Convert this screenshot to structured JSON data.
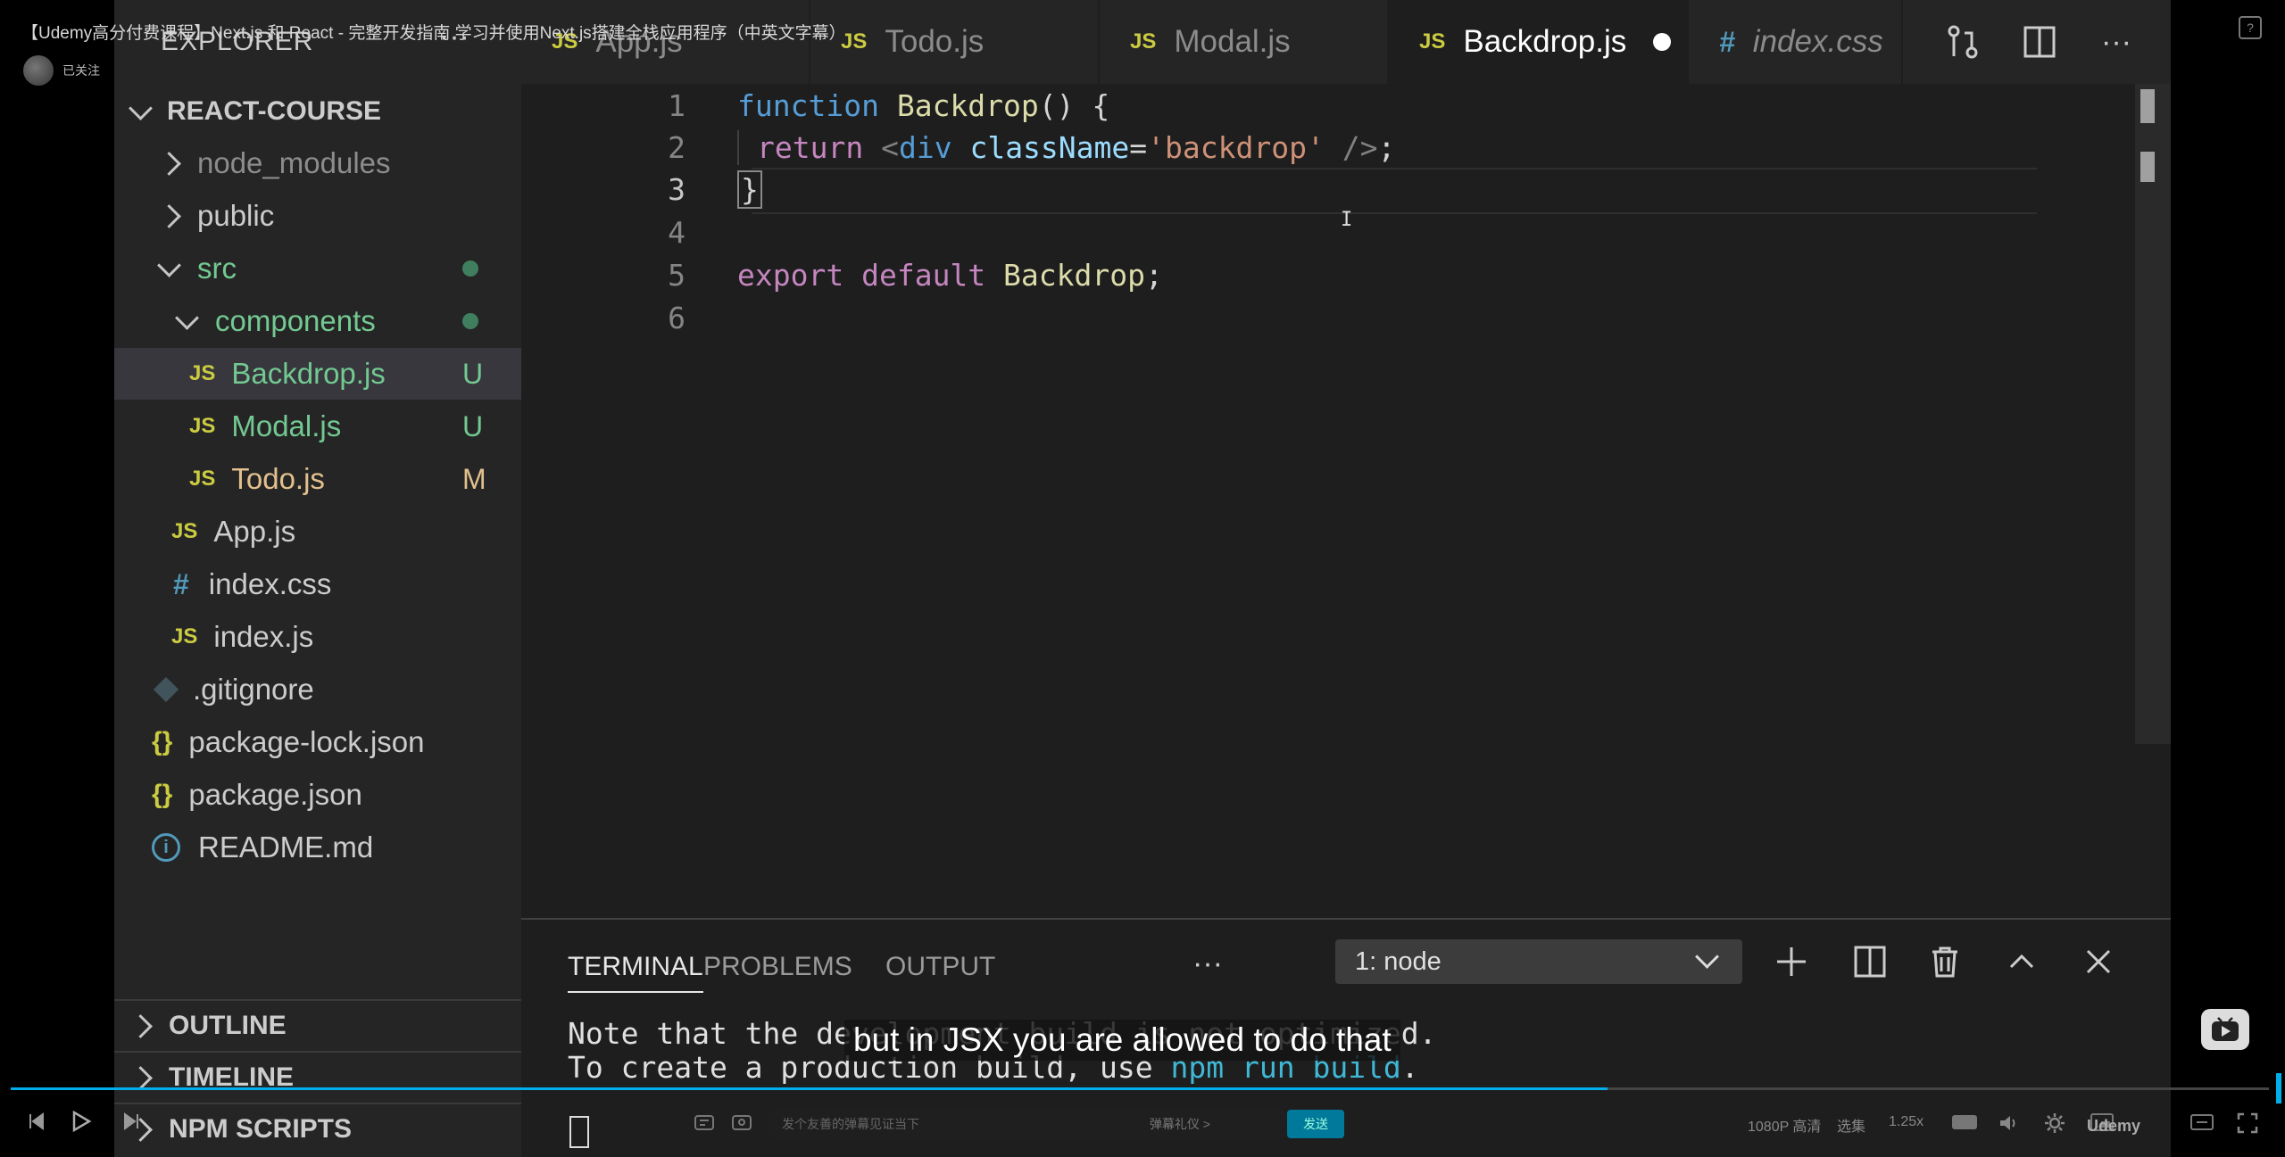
{
  "player": {
    "video_title": "【Udemy高分付费课程】Next.js 和 React - 完整开发指南 学习并使用Next.js搭建全栈应用程序（中英文字幕）",
    "uploader_status": "已关注",
    "subtitle": "but in JSX you are allowed to do that",
    "danmu_placeholder": "发个友善的弹幕见证当下",
    "danmu_etiquette": "弹幕礼仪 >",
    "send_label": "发送",
    "quality": "1080P 高清",
    "episodes": "选集",
    "speed": "1.25x",
    "udemy_logo": "Udemy",
    "progress": 0.707
  },
  "sidebar": {
    "header": "EXPLORER",
    "more": "···",
    "project": "REACT-COURSE",
    "tree": [
      {
        "label": "node_modules",
        "type": "folder",
        "open": false,
        "depth": 1,
        "muted": true
      },
      {
        "label": "public",
        "type": "folder",
        "open": false,
        "depth": 1
      },
      {
        "label": "src",
        "type": "folder",
        "open": true,
        "depth": 1,
        "color": "green",
        "dot": true
      },
      {
        "label": "components",
        "type": "folder",
        "open": true,
        "depth": 2,
        "color": "green",
        "dot": true
      },
      {
        "label": "Backdrop.js",
        "type": "js",
        "depth": 3,
        "color": "green",
        "badge": "U",
        "selected": true
      },
      {
        "label": "Modal.js",
        "type": "js",
        "depth": 3,
        "color": "green",
        "badge": "U"
      },
      {
        "label": "Todo.js",
        "type": "js",
        "depth": 3,
        "color": "amber",
        "badge": "M"
      },
      {
        "label": "App.js",
        "type": "js",
        "depth": 2
      },
      {
        "label": "index.css",
        "type": "css",
        "depth": 2
      },
      {
        "label": "index.js",
        "type": "js",
        "depth": 2
      },
      {
        "label": ".gitignore",
        "type": "git",
        "depth": 1
      },
      {
        "label": "package-lock.json",
        "type": "json",
        "depth": 1
      },
      {
        "label": "package.json",
        "type": "json",
        "depth": 1
      },
      {
        "label": "README.md",
        "type": "info",
        "depth": 1
      }
    ],
    "sections": [
      "OUTLINE",
      "TIMELINE",
      "NPM SCRIPTS"
    ]
  },
  "tabs": [
    {
      "label": "App.js",
      "icon": "JS"
    },
    {
      "label": "Todo.js",
      "icon": "JS"
    },
    {
      "label": "Modal.js",
      "icon": "JS"
    },
    {
      "label": "Backdrop.js",
      "icon": "JS",
      "active": true,
      "dirty": true
    },
    {
      "label": "index.css",
      "icon": "#"
    }
  ],
  "editor": {
    "line_numbers": [
      "1",
      "2",
      "3",
      "4",
      "5",
      "6"
    ],
    "code": {
      "l1": {
        "kw": "function",
        "name": "Backdrop",
        "rest": "() {"
      },
      "l2": {
        "kw": "return",
        "lt": "<",
        "tag": "div",
        "attr": "className",
        "eq": "=",
        "str": "'backdrop'",
        "close": "/>",
        "end": ";"
      },
      "l3": {
        "brace": "}"
      },
      "l5": {
        "kw1": "export",
        "kw2": "default",
        "name": "Backdrop",
        "end": ";"
      }
    }
  },
  "panel": {
    "tabs": [
      "TERMINAL",
      "PROBLEMS",
      "OUTPUT"
    ],
    "more": "···",
    "terminal_select": "1: node",
    "lines": {
      "l1": "Note that the development build is not optimized.",
      "l2_pre": "To create a production build, use ",
      "l2_cmd": "npm run build",
      "l2_post": "."
    }
  }
}
